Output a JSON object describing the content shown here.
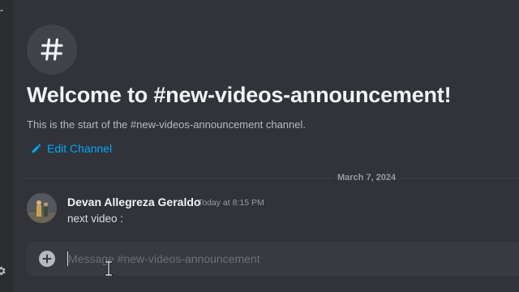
{
  "channel": {
    "icon": "hash-icon",
    "welcome_title": "Welcome to #new-videos-announcement!",
    "welcome_subtitle": "This is the start of the #new-videos-announcement channel.",
    "edit_label": "Edit Channel"
  },
  "divider": {
    "date": "March 7, 2024"
  },
  "message": {
    "author": "Devan Allegreza Geraldo",
    "timestamp": "Today at 8:15 PM",
    "content": "next video :"
  },
  "composer": {
    "placeholder": "Message #new-videos-announcement"
  },
  "colors": {
    "background": "#313338",
    "link": "#00a8fc",
    "composer": "#383a40"
  }
}
